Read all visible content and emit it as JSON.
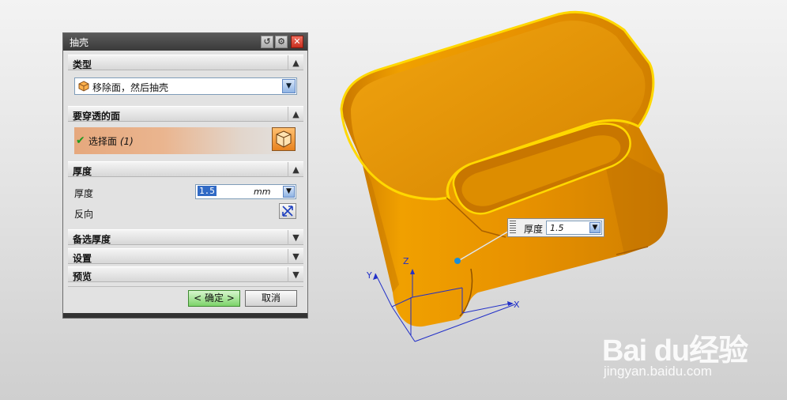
{
  "dialog": {
    "title": "抽壳",
    "sections": {
      "type": {
        "label": "类型"
      },
      "faces": {
        "label": "要穿透的面"
      },
      "thickness": {
        "label": "厚度"
      },
      "alt_thickness": {
        "label": "备选厚度"
      },
      "settings": {
        "label": "设置"
      },
      "preview": {
        "label": "预览"
      }
    },
    "type_dropdown": {
      "value": "移除面，然后抽壳"
    },
    "select_face": {
      "label": "选择面",
      "count": "(1)"
    },
    "thickness": {
      "label": "厚度",
      "value": "1.5",
      "unit": "mm"
    },
    "reverse": {
      "label": "反向"
    },
    "buttons": {
      "ok": "< 确定 >",
      "cancel": "取消"
    }
  },
  "viewport": {
    "thickness_tip": {
      "label": "厚度",
      "value": "1.5"
    },
    "axes": {
      "x": "X",
      "y": "Y",
      "z": "Z"
    }
  },
  "watermark": {
    "brand": "Bai du经验",
    "url": "jingyan.baidu.com"
  },
  "colors": {
    "part": "#f0a000",
    "edge": "#ffd800",
    "accent": "#316ac5",
    "ok": "#7dd46a"
  }
}
